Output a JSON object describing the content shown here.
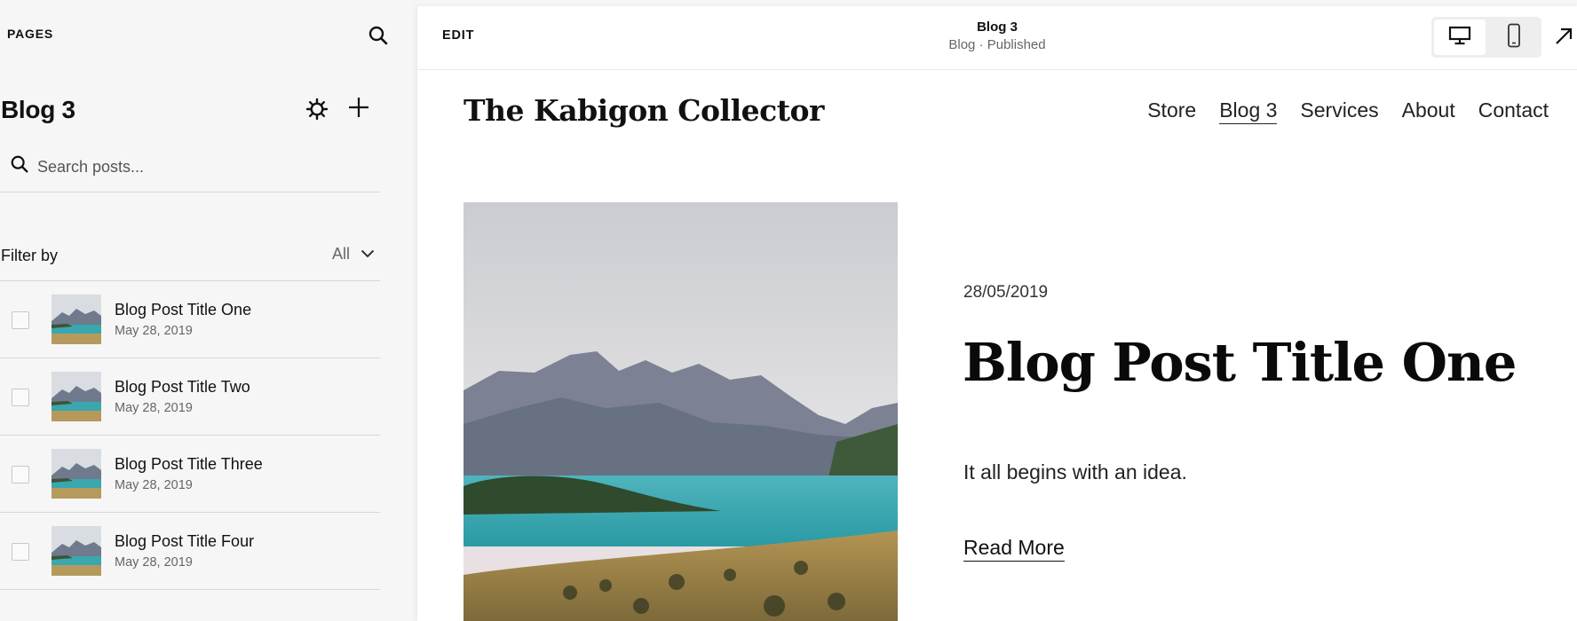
{
  "sidebar": {
    "header": "PAGES",
    "page_title": "Blog 3",
    "search": {
      "placeholder": "Search posts..."
    },
    "filter": {
      "label": "Filter by",
      "value": "All"
    },
    "posts": [
      {
        "title": "Blog Post Title One",
        "date": "May 28, 2019"
      },
      {
        "title": "Blog Post Title Two",
        "date": "May 28, 2019"
      },
      {
        "title": "Blog Post Title Three",
        "date": "May 28, 2019"
      },
      {
        "title": "Blog Post Title Four",
        "date": "May 28, 2019"
      }
    ]
  },
  "topbar": {
    "edit_label": "EDIT",
    "page_name": "Blog 3",
    "page_status": "Blog · Published"
  },
  "site": {
    "logo": "The Kabigon Collector",
    "nav": [
      "Store",
      "Blog 3",
      "Services",
      "About",
      "Contact"
    ],
    "active_nav": "Blog 3"
  },
  "post": {
    "date": "28/05/2019",
    "title": "Blog Post Title One",
    "excerpt": "It all begins with an idea.",
    "read_more": "Read More"
  },
  "icons": {
    "sidebar_search": "search-icon",
    "settings": "gear-icon",
    "add": "plus-icon",
    "filter_dropdown": "chevron-down-icon",
    "desktop": "desktop-icon",
    "mobile": "mobile-icon",
    "open": "arrow-up-right-icon"
  },
  "colors": {
    "sidebar_bg": "#f6f6f6",
    "preview_bg": "#ffffff",
    "text": "#111111",
    "muted": "#666666",
    "divider": "#d6d6d6"
  }
}
